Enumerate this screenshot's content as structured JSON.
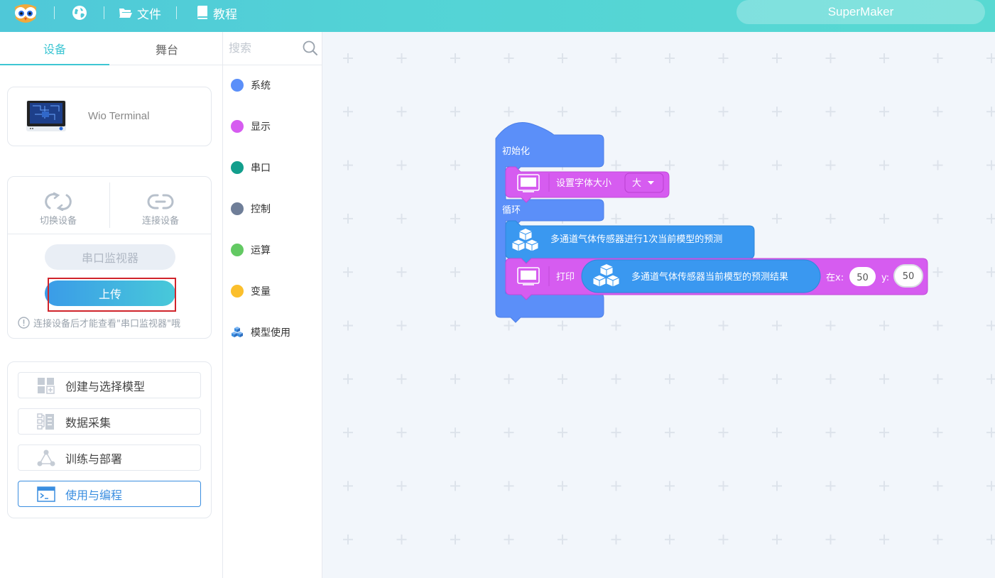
{
  "topbar": {
    "menu_file": "文件",
    "menu_tutorial": "教程",
    "user_name": "SuperMaker",
    "icons": {
      "logo": "owl-logo-icon",
      "language": "globe-icon",
      "file": "folder-icon",
      "tutorial": "book-icon"
    }
  },
  "left": {
    "tabs": [
      "设备",
      "舞台"
    ],
    "active_tab": "设备",
    "device_name": "Wio Terminal",
    "switch_device": "切换设备",
    "connect_device": "连接设备",
    "serial_monitor": "串口监视器",
    "upload": "上传",
    "hint": "连接设备后才能查看\"串口监视器\"哦",
    "flow": [
      "创建与选择模型",
      "数据采集",
      "训练与部署",
      "使用与编程"
    ],
    "active_flow": "使用与编程"
  },
  "categories": {
    "search_placeholder": "搜索",
    "items": [
      {
        "label": "系统",
        "color": "#5b8ff9"
      },
      {
        "label": "显示",
        "color": "#d65cf0"
      },
      {
        "label": "串口",
        "color": "#129e8c"
      },
      {
        "label": "控制",
        "color": "#6f7e98"
      },
      {
        "label": "运算",
        "color": "#63c963"
      },
      {
        "label": "变量",
        "color": "#fbbf2c"
      },
      {
        "label": "模型使用",
        "color": "#3a8ee0",
        "icon": "cubes-icon"
      }
    ]
  },
  "blocks": {
    "init_label": "初始化",
    "set_font_label": "设置字体大小",
    "font_size_value": "大",
    "loop_label": "循环",
    "predict_label": "多通道气体传感器进行1次当前模型的预测",
    "print_label": "打印",
    "result_label": "多通道气体传感器当前模型的预测结果",
    "at_x_label": "在x:",
    "x_value": "50",
    "y_label": "y:",
    "y_value": "50",
    "colors": {
      "system": "#5b8ff9",
      "display": "#d65cf0",
      "model": "#3a98f0"
    }
  }
}
